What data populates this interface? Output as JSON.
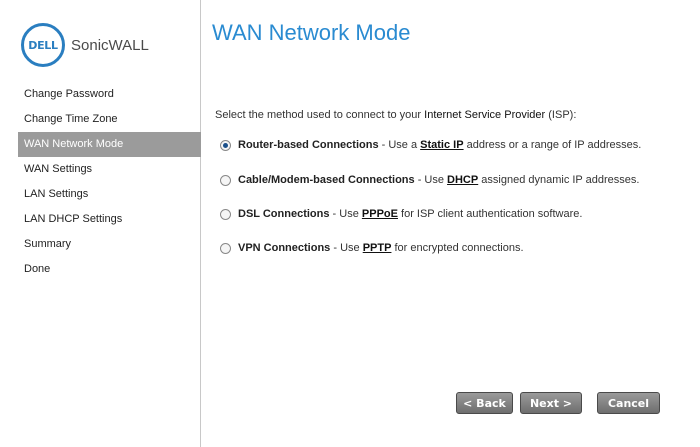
{
  "brand": {
    "badge": "DELL",
    "name": "SonicWALL",
    "color": "#2a7ec0"
  },
  "sidebar": {
    "items": [
      {
        "label": "Change Password",
        "active": false
      },
      {
        "label": "Change Time Zone",
        "active": false
      },
      {
        "label": "WAN Network Mode",
        "active": true
      },
      {
        "label": "WAN Settings",
        "active": false
      },
      {
        "label": "LAN Settings",
        "active": false
      },
      {
        "label": "LAN DHCP Settings",
        "active": false
      },
      {
        "label": "Summary",
        "active": false
      },
      {
        "label": "Done",
        "active": false
      }
    ]
  },
  "main": {
    "title": "WAN Network Mode",
    "instruction": {
      "prefix": "Select the method used to connect to your ",
      "emphasis": "Internet Service Provider",
      "suffix": " (ISP):"
    },
    "options": [
      {
        "name": "Router-based Connections",
        "pre": " - Use a ",
        "link": "Static IP",
        "post": " address or a range of IP addresses.",
        "selected": true
      },
      {
        "name": "Cable/Modem-based Connections",
        "pre": " - Use ",
        "link": "DHCP",
        "post": " assigned dynamic IP addresses.",
        "selected": false
      },
      {
        "name": "DSL Connections",
        "pre": " - Use ",
        "link": "PPPoE",
        "post": " for ISP client authentication software.",
        "selected": false
      },
      {
        "name": "VPN Connections",
        "pre": " - Use ",
        "link": "PPTP",
        "post": " for encrypted connections.",
        "selected": false
      }
    ]
  },
  "buttons": {
    "back": "< Back",
    "next": "Next >",
    "cancel": "Cancel"
  },
  "colors": {
    "title": "#2a8bd1",
    "active_nav": "#9b9b9b"
  }
}
